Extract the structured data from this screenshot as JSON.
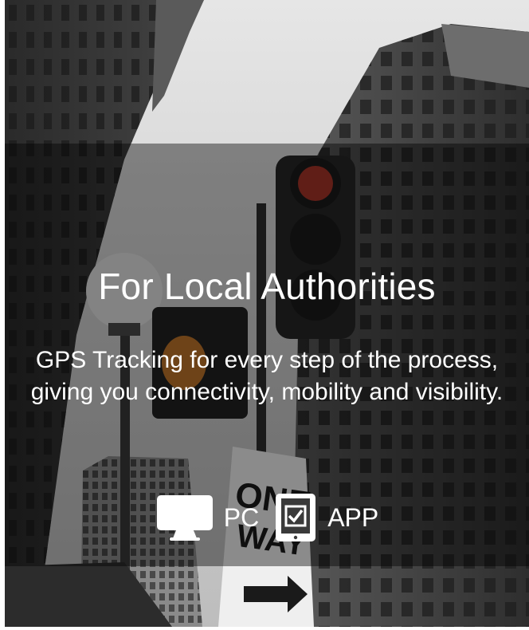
{
  "hero": {
    "title": "For Local Authorities",
    "description": "GPS Tracking for every step of the process, giving you connectivity, mobility and visibility."
  },
  "platforms": [
    {
      "label": "PC",
      "icon": "monitor-icon"
    },
    {
      "label": "APP",
      "icon": "tablet-check-icon"
    }
  ],
  "colors": {
    "overlay": "rgba(0,0,0,0.42)",
    "text": "#ffffff",
    "signal_red": "#c0392b",
    "hand_orange": "#d9822b"
  }
}
